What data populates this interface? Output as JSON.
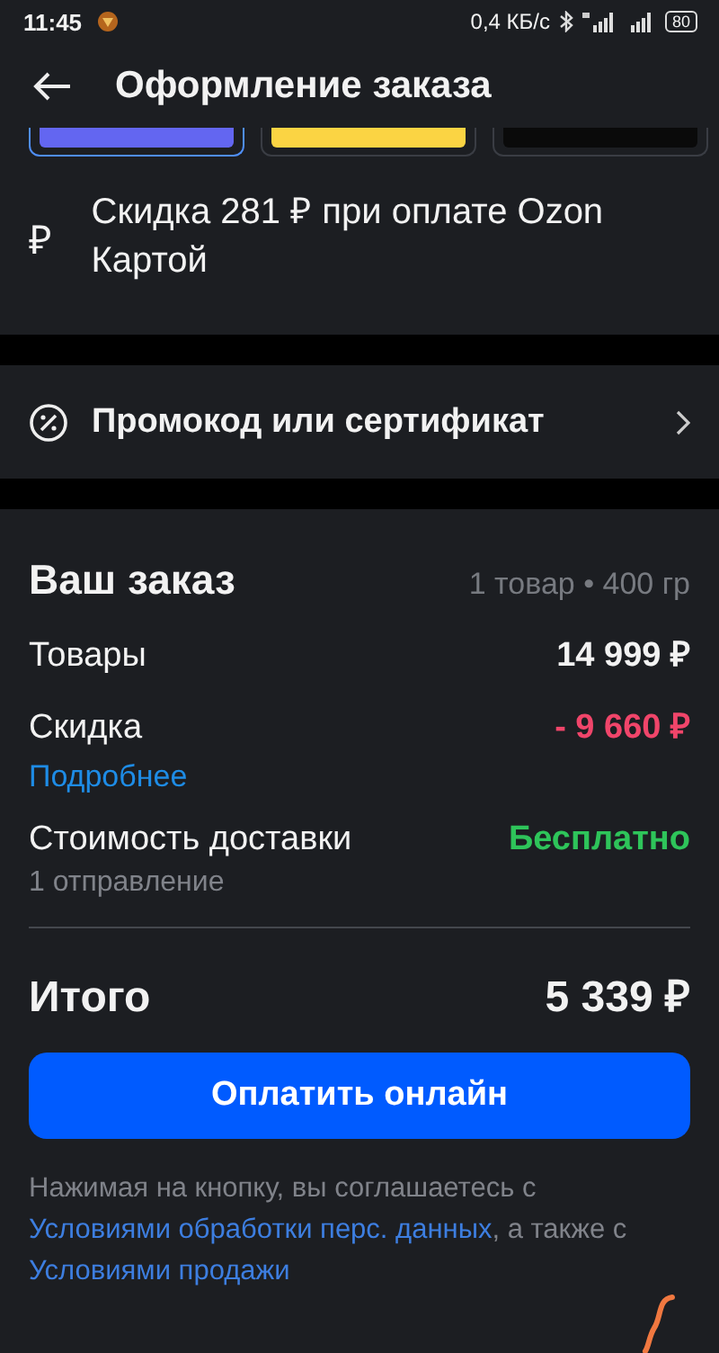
{
  "status_bar": {
    "time": "11:45",
    "speed": "0,4 КБ/с",
    "battery": "80"
  },
  "header": {
    "title": "Оформление заказа"
  },
  "payment_cards": [
    {
      "color": "#6366f1",
      "selected": true
    },
    {
      "color": "#fbd443",
      "selected": false
    },
    {
      "color": "#0a0a0a",
      "selected": false
    }
  ],
  "card_discount": {
    "icon": "₽",
    "text": "Скидка 281 ₽ при оплате Ozon Картой"
  },
  "promo": {
    "label": "Промокод или сертификат"
  },
  "order": {
    "title": "Ваш заказ",
    "summary": "1 товар • 400 гр",
    "rows": [
      {
        "label": "Товары",
        "value": "14 999 ₽",
        "kind": "normal"
      },
      {
        "label": "Скидка",
        "value": "- 9 660 ₽",
        "kind": "discount",
        "link": "Подробнее"
      },
      {
        "label": "Стоимость доставки",
        "value": "Бесплатно",
        "kind": "free",
        "note": "1 отправление"
      }
    ],
    "total_label": "Итого",
    "total_value": "5 339 ₽"
  },
  "pay_button": "Оплатить онлайн",
  "legal": [
    {
      "text": "Нажимая на кнопку, вы соглашаетесь с ",
      "kind": "text"
    },
    {
      "text": "Условиями обработки перс. данных",
      "kind": "link"
    },
    {
      "text": ", а также с ",
      "kind": "text"
    },
    {
      "text": "Условиями продажи",
      "kind": "link"
    }
  ]
}
